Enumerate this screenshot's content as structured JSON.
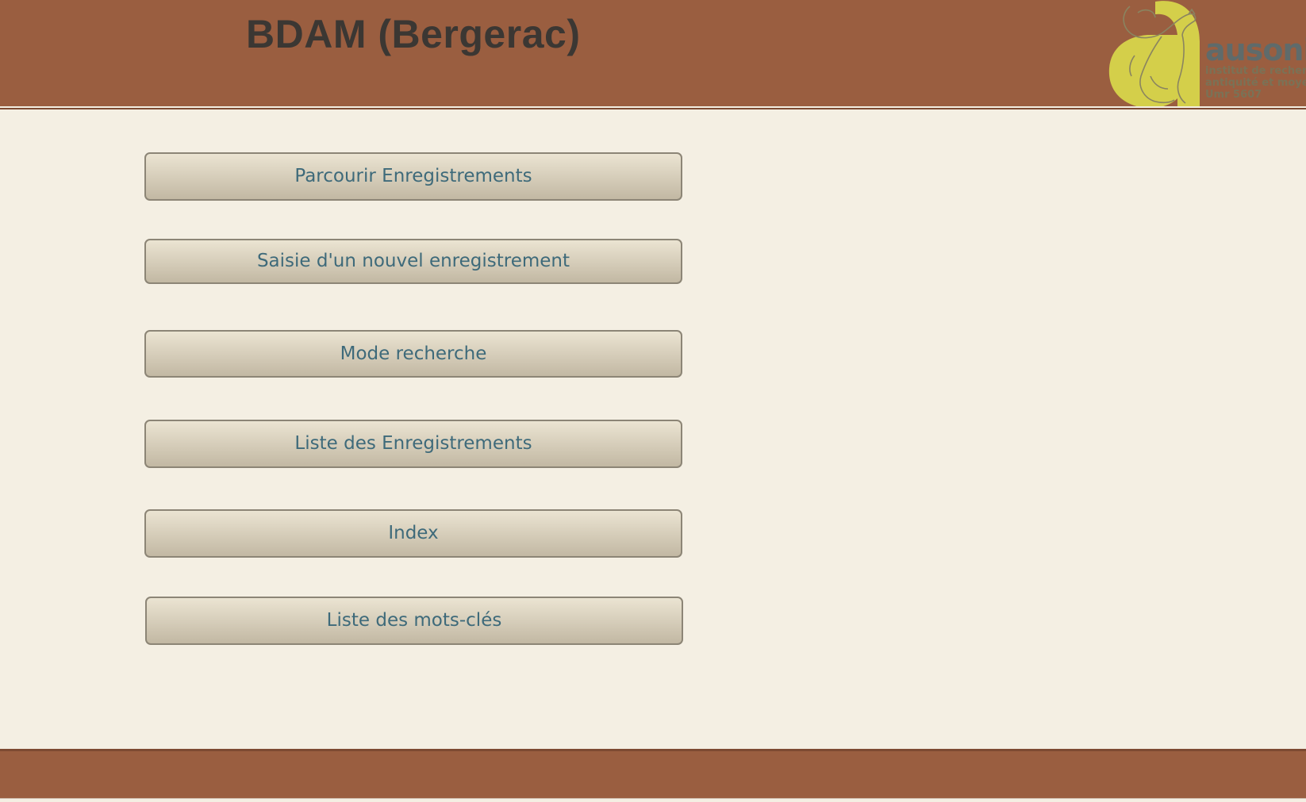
{
  "header": {
    "title": "BDAM (Bergerac)",
    "logo": {
      "name": "ausoniu",
      "sub_line_1": "institut de recherche",
      "sub_line_2": "antiquité et moyen â",
      "sub_line_3": "Umr 5607"
    }
  },
  "menu": {
    "items": [
      {
        "label": "Parcourir Enregistrements"
      },
      {
        "label": "Saisie d'un nouvel enregistrement"
      },
      {
        "label": "Mode recherche"
      },
      {
        "label": "Liste des Enregistrements"
      },
      {
        "label": "Index"
      },
      {
        "label": "Liste des mots-clés"
      }
    ]
  },
  "colors": {
    "header_bg": "#9a5e40",
    "page_bg": "#f4efe3",
    "button_text": "#3e6a7a",
    "title_text": "#3b3733",
    "logo_yellow": "#d4cf4a"
  }
}
